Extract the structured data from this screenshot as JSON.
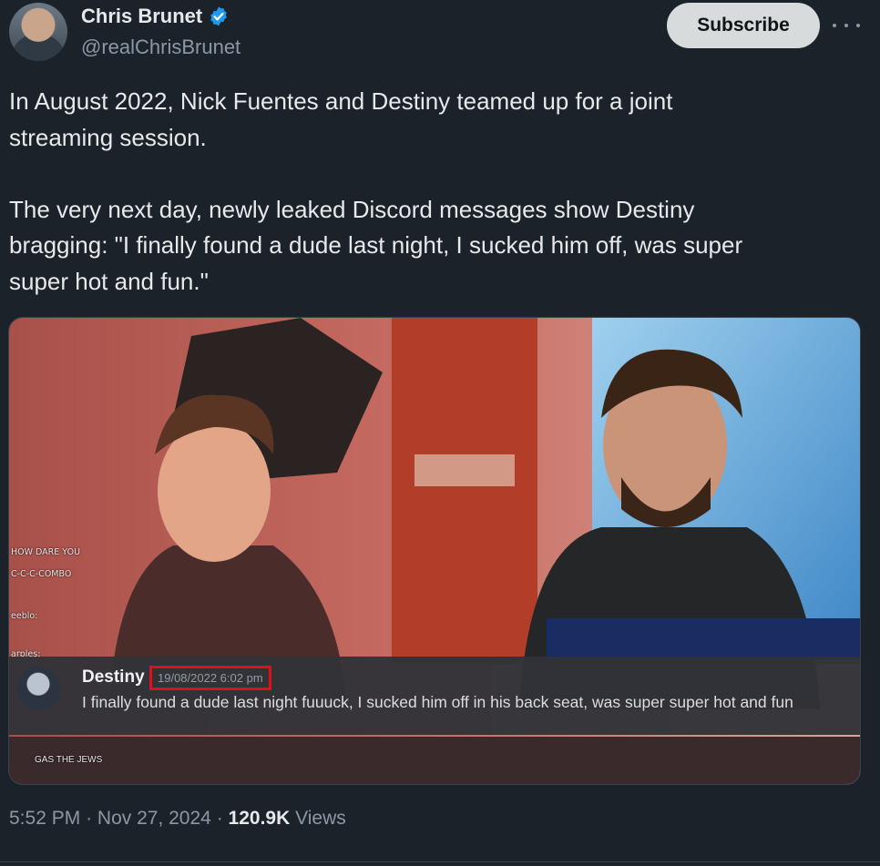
{
  "author": {
    "display_name": "Chris Brunet",
    "handle": "@realChrisBrunet",
    "verified_icon": "verified-badge-icon",
    "avatar_icon": "profile-photo"
  },
  "actions": {
    "subscribe_label": "Subscribe",
    "more_icon": "ellipsis-icon"
  },
  "tweet": {
    "text": "In August 2022, Nick Fuentes and Destiny teamed up for a joint\nstreaming session.\n\nThe very next day, newly leaked Discord messages show Destiny\nbragging: \"I finally found a dude last night, I sucked him off, was super\nsuper hot and fun.\""
  },
  "media": {
    "discord_author": "Destiny",
    "discord_timestamp": "19/08/2022 6:02 pm",
    "discord_message": "I finally found a dude last night fuuuck, I sucked him off in his back seat, was super super hot and fun",
    "chat_lines": [
      "HOW DARE YOU",
      "C-C-C-COMBO",
      "eeblo:",
      "arples:"
    ],
    "chat_bottom": "GAS THE JEWS"
  },
  "meta": {
    "time": "5:52 PM",
    "date": "Nov 27, 2024",
    "views_count": "120.9K",
    "views_label": "Views",
    "separator": "·"
  },
  "colors": {
    "background": "#1c2229",
    "text_primary": "#e7e9ea",
    "text_secondary": "#8b98a5",
    "verified_blue": "#1d9bf0",
    "subscribe_bg": "#d7dbdc",
    "timestamp_highlight": "#e0101a"
  }
}
